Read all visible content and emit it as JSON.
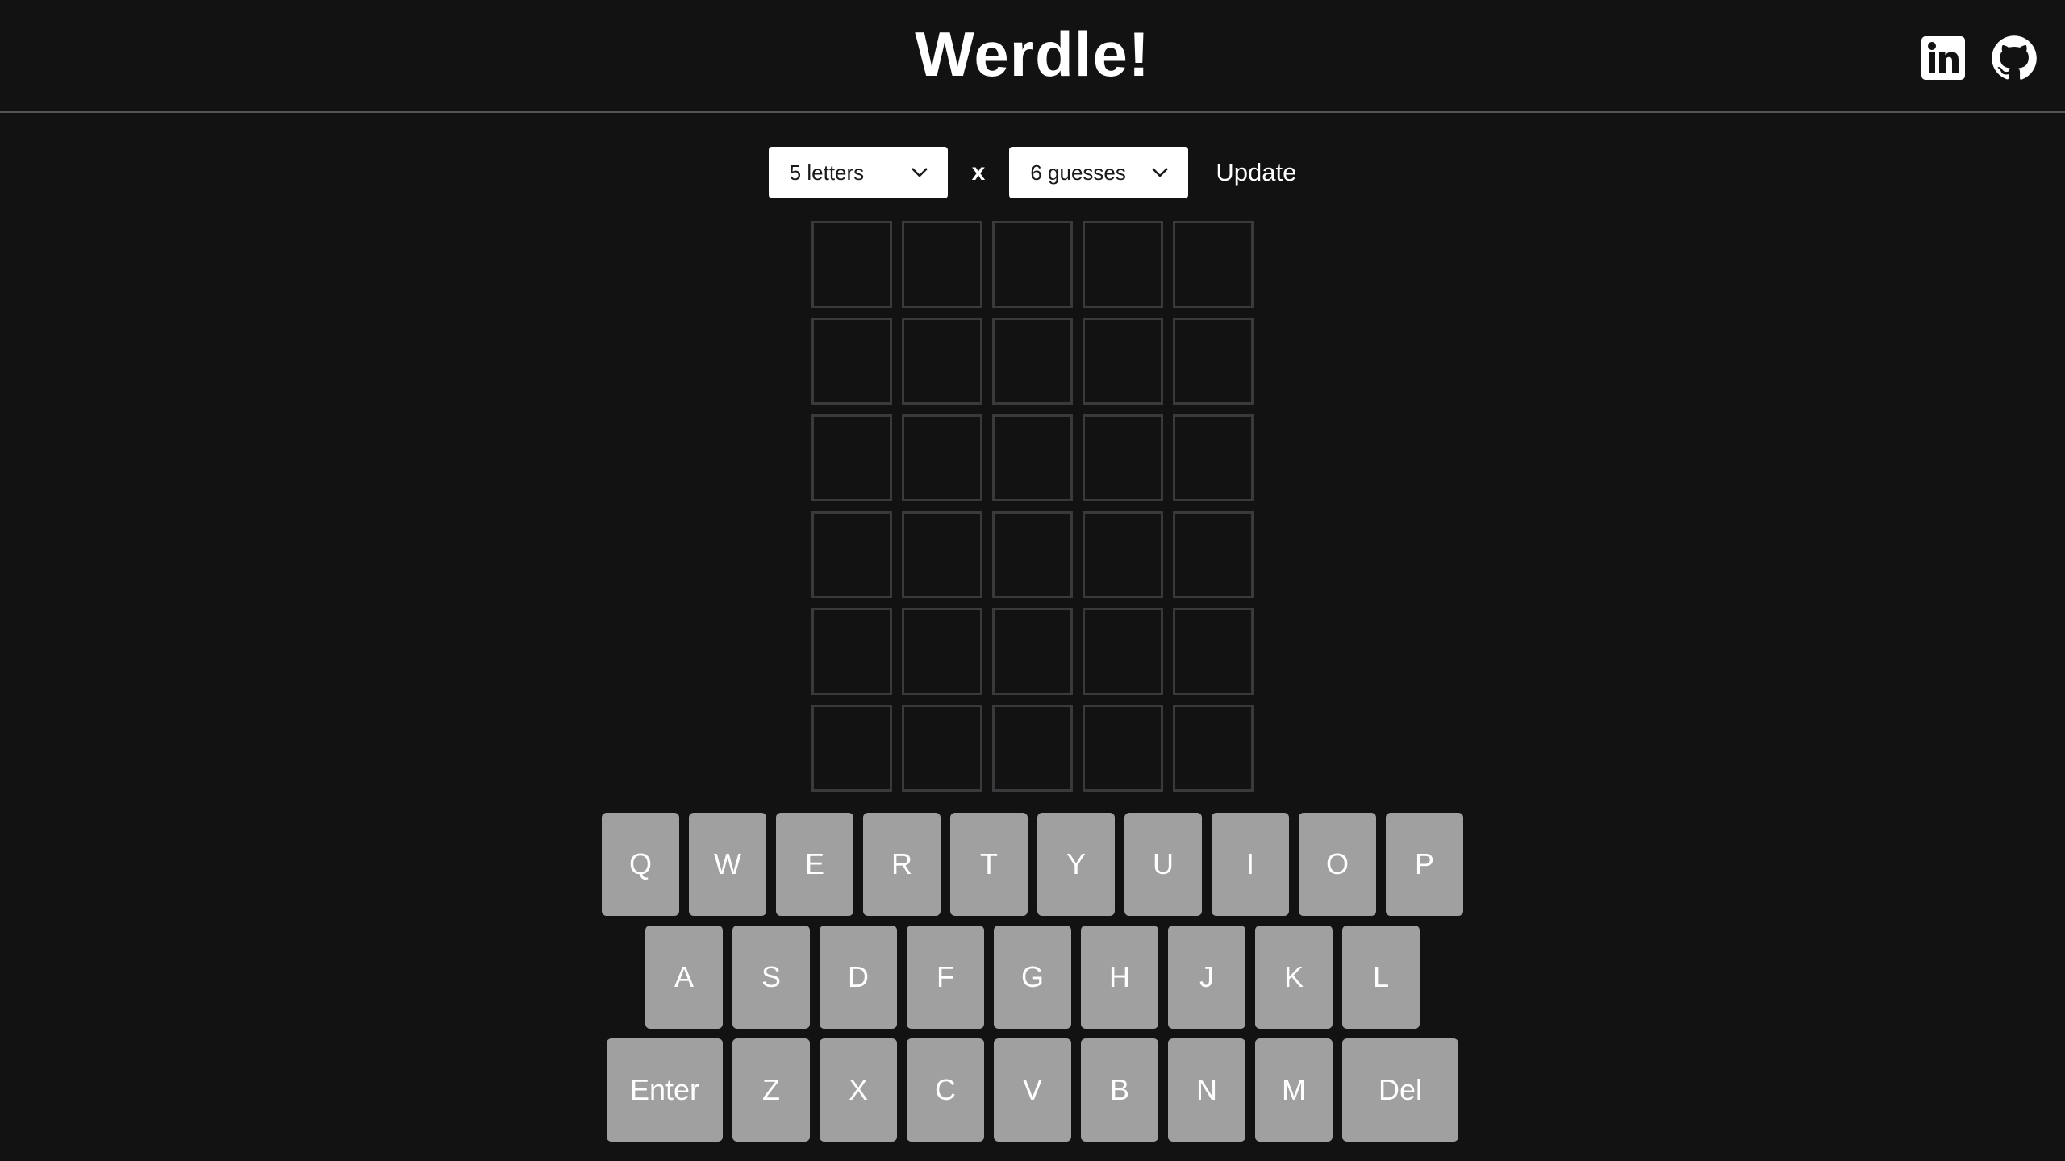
{
  "header": {
    "title": "Werdle!",
    "icons": [
      "linkedin-icon",
      "github-icon"
    ]
  },
  "controls": {
    "letters_value": "5 letters",
    "times": "x",
    "guesses_value": "6 guesses",
    "update_label": "Update"
  },
  "board": {
    "rows": 6,
    "cols": 5,
    "tiles": [
      [
        "",
        "",
        "",
        "",
        ""
      ],
      [
        "",
        "",
        "",
        "",
        ""
      ],
      [
        "",
        "",
        "",
        "",
        ""
      ],
      [
        "",
        "",
        "",
        "",
        ""
      ],
      [
        "",
        "",
        "",
        "",
        ""
      ],
      [
        "",
        "",
        "",
        "",
        ""
      ]
    ]
  },
  "keyboard": {
    "row1": [
      "Q",
      "W",
      "E",
      "R",
      "T",
      "Y",
      "U",
      "I",
      "O",
      "P"
    ],
    "row2": [
      "A",
      "S",
      "D",
      "F",
      "G",
      "H",
      "J",
      "K",
      "L"
    ],
    "row3": [
      "Enter",
      "Z",
      "X",
      "C",
      "V",
      "B",
      "N",
      "M",
      "Del"
    ]
  },
  "colors": {
    "background": "#121213",
    "tile_border": "#3a3a3c",
    "key": "#a0a0a0",
    "header_border": "#545454"
  }
}
